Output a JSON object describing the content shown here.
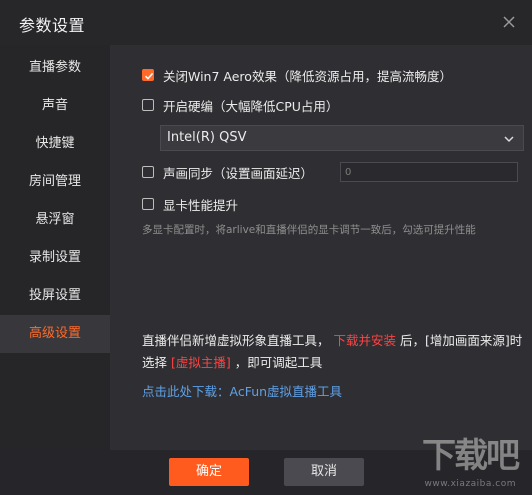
{
  "window": {
    "title": "参数设置"
  },
  "sidebar": {
    "items": [
      {
        "label": "直播参数"
      },
      {
        "label": "声音"
      },
      {
        "label": "快捷键"
      },
      {
        "label": "房间管理"
      },
      {
        "label": "悬浮窗"
      },
      {
        "label": "录制设置"
      },
      {
        "label": "投屏设置"
      },
      {
        "label": "高级设置",
        "active": true
      }
    ]
  },
  "options": {
    "aero": {
      "label": "关闭Win7 Aero效果（降低资源占用，提高流畅度）",
      "checked": true
    },
    "hw_encode": {
      "label": "开启硬编（大幅降低CPU占用）",
      "checked": false
    },
    "encoder_select": {
      "value": "Intel(R) QSV"
    },
    "av_sync": {
      "label": "声画同步（设置画面延迟）",
      "checked": false
    },
    "delay_input": {
      "placeholder": "0"
    },
    "gpu_boost": {
      "label": "显卡性能提升",
      "checked": false
    },
    "gpu_hint": "多显卡配置时，将arlive和直播伴侣的显卡调节一致后，勾选可提升性能"
  },
  "promo": {
    "part1": "直播伴侣新增虚拟形象直播工具，",
    "part2": "下载并安装",
    "part3": "后，[增加画面来源]时选择",
    "part4": "[虚拟主播]",
    "part5": "，即可调起工具",
    "download_link": "点击此处下载：AcFun虚拟直播工具"
  },
  "footer": {
    "ok_label": "确定",
    "cancel_label": "取消"
  },
  "watermark": {
    "mark": "下载吧",
    "site": "www.xiazaiba.com"
  },
  "colors": {
    "accent": "#ff5b1f",
    "link": "#5fa0e6",
    "highlight_red": "#ff4343"
  },
  "icons": {
    "close": "close-icon",
    "chevron": "chevron-down-icon",
    "check": "checkmark-icon"
  }
}
